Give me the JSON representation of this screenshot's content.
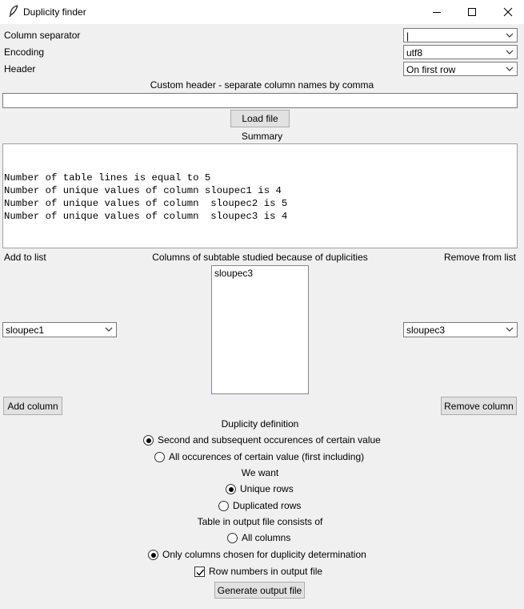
{
  "window": {
    "title": "Duplicity finder",
    "icons": [
      "feather-icon",
      "minimize-icon",
      "maximize-icon",
      "close-icon"
    ]
  },
  "settings": {
    "column_separator_label": "Column separator",
    "column_separator_value": "|",
    "encoding_label": "Encoding",
    "encoding_value": "utf8",
    "header_label": "Header",
    "header_value": "On first row",
    "custom_header_label": "Custom header - separate column names by comma",
    "custom_header_value": ""
  },
  "load_button": "Load file",
  "summary": {
    "label": "Summary",
    "lines": [
      "Number of table lines is equal to 5",
      "Number of unique values of column sloupec1 is 4",
      "Number of unique values of column  sloupec2 is 5",
      "Number of unique values of column  sloupec3 is 4"
    ]
  },
  "columns": {
    "add_label": "Add to list",
    "studied_label": "Columns of subtable studied because of duplicities",
    "remove_label": "Remove from list",
    "add_select_value": "sloupec1",
    "remove_select_value": "sloupec3",
    "studied_items": [
      "sloupec3"
    ],
    "add_button": "Add column",
    "remove_button": "Remove column"
  },
  "duplicity": {
    "label": "Duplicity definition",
    "options": [
      {
        "label": "Second and subsequent occurences of certain value",
        "selected": true
      },
      {
        "label": "All occurences of certain value (first including)",
        "selected": false
      }
    ]
  },
  "want": {
    "label": "We want",
    "options": [
      {
        "label": "Unique rows",
        "selected": true
      },
      {
        "label": "Duplicated rows",
        "selected": false
      }
    ]
  },
  "output": {
    "label": "Table in output file consists of",
    "options": [
      {
        "label": "All columns",
        "selected": false
      },
      {
        "label": "Only columns chosen for duplicity determination",
        "selected": true
      }
    ],
    "row_numbers_label": "Row numbers in output file",
    "row_numbers_checked": true,
    "generate_button": "Generate output file"
  }
}
